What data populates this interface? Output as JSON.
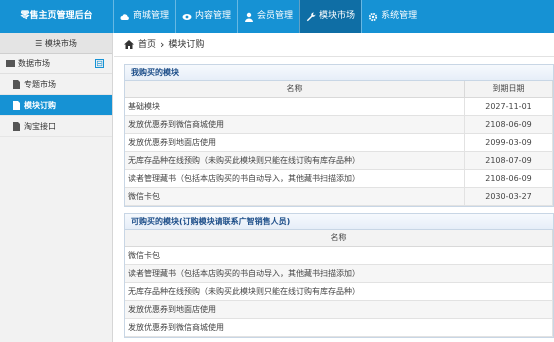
{
  "header": {
    "brand": "零售主页管理后台",
    "nav": [
      {
        "label": "商城管理",
        "icon": "cloud-icon"
      },
      {
        "label": "内容管理",
        "icon": "eye-icon"
      },
      {
        "label": "会员管理",
        "icon": "user-icon"
      },
      {
        "label": "模块市场",
        "icon": "wrench-icon",
        "active": true
      },
      {
        "label": "系统管理",
        "icon": "gear-icon"
      }
    ]
  },
  "sidebar": {
    "title": "☰ 模块市场",
    "group": {
      "label": "数据市场",
      "collapse": "⊟"
    },
    "items": [
      {
        "label": "专题市场"
      },
      {
        "label": "模块订购",
        "active": true
      },
      {
        "label": "淘宝接口"
      }
    ]
  },
  "breadcrumb": {
    "home": "首页",
    "sep": "›",
    "current": "模块订购"
  },
  "purchased": {
    "title": "我购买的模块",
    "columns": [
      "名称",
      "到期日期"
    ],
    "rows": [
      {
        "name": "基础模块",
        "date": "2027-11-01"
      },
      {
        "name": "发放优惠券到微信商城使用",
        "date": "2108-06-09"
      },
      {
        "name": "发放优惠券到地面店使用",
        "date": "2099-03-09"
      },
      {
        "name": "无库存品种在线预购（未购买此模块则只能在线订购有库存品种）",
        "date": "2108-07-09"
      },
      {
        "name": "读者管理藏书（包括本店购买的书自动导入，其他藏书扫描添加）",
        "date": "2108-06-09"
      },
      {
        "name": "微信卡包",
        "date": "2030-03-27"
      }
    ]
  },
  "available": {
    "title": "可购买的模块(订购模块请联系广智销售人员)",
    "columns": [
      "名称"
    ],
    "rows": [
      "微信卡包",
      "读者管理藏书（包括本店购买的书自动导入，其他藏书扫描添加）",
      "无库存品种在线预购（未购买此模块则只能在线订购有库存品种）",
      "发放优惠券到地面店使用",
      "发放优惠券到微信商城使用"
    ]
  }
}
